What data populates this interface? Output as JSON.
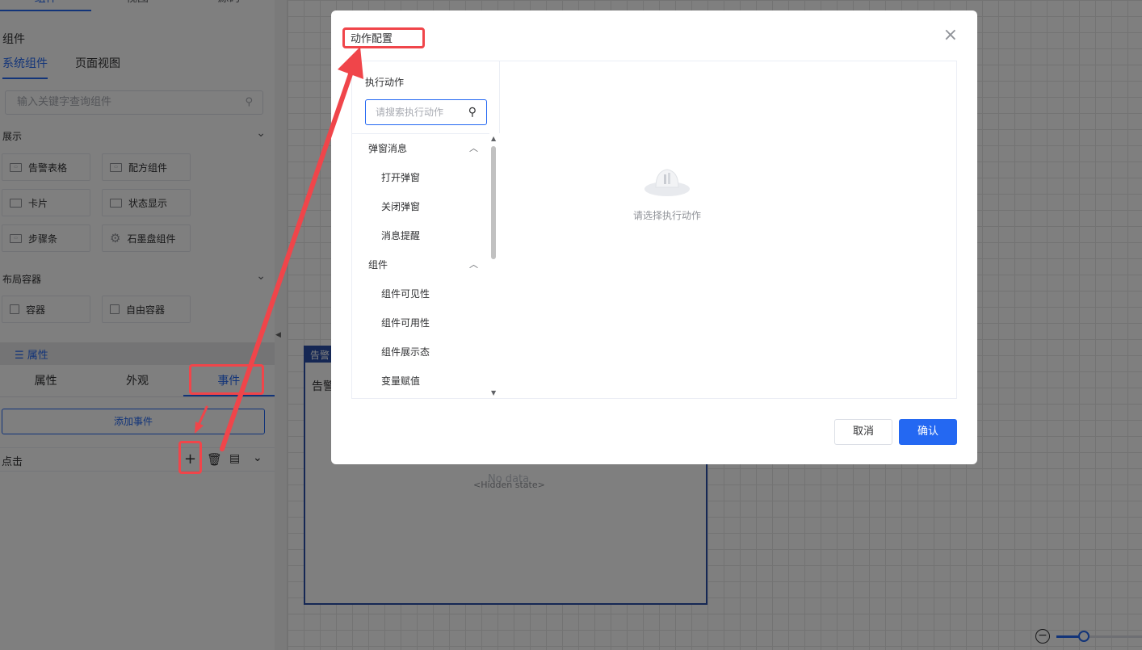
{
  "left_panel": {
    "top_tabs": [
      "组件",
      "视图",
      "源码"
    ],
    "section_title": "组件",
    "sub_tabs": [
      "系统组件",
      "页面视图"
    ],
    "search_placeholder": "输入关键字查询组件",
    "groups": [
      {
        "title": "展示",
        "items": [
          "告警表格",
          "配方组件",
          "卡片",
          "状态显示",
          "步骤条",
          "石墨盘组件"
        ]
      },
      {
        "title": "布局容器",
        "items": [
          "容器",
          "自由容器"
        ]
      }
    ],
    "properties_header": "属性",
    "property_tabs": [
      "属性",
      "外观",
      "事件"
    ],
    "add_event_label": "添加事件",
    "event_row_label": "点击"
  },
  "canvas": {
    "widget_tag": "告警",
    "widget_title": "告警",
    "no_data": "No data",
    "hidden_state": "<Hidden state>"
  },
  "dialog": {
    "title": "动作配置",
    "left_header": "执行动作",
    "search_placeholder": "请搜索执行动作",
    "tree": [
      {
        "label": "弹窗消息",
        "children": [
          "打开弹窗",
          "关闭弹窗",
          "消息提醒"
        ]
      },
      {
        "label": "组件",
        "children": [
          "组件可见性",
          "组件可用性",
          "组件展示态",
          "变量赋值"
        ]
      }
    ],
    "empty_text": "请选择执行动作",
    "cancel_label": "取消",
    "confirm_label": "确认"
  },
  "colors": {
    "primary": "#2468f2",
    "annotation": "#f0454a",
    "widget_border": "#2a4fa8"
  }
}
